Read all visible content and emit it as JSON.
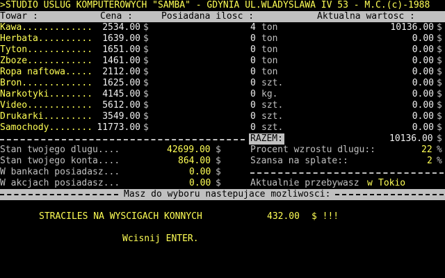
{
  "title": ">STUDIO USLUG KOMPUTEROWYCH \"SAMBA\" - GDYNIA UL.WLADYSLAWA IV 53 - M.C.(c)-1988",
  "headers": {
    "towar": "Towar :",
    "cena": "Cena :",
    "posiadana": "Posiadana ilosc :",
    "wartosc": "Aktualna wartosc :"
  },
  "goods": [
    {
      "name": "Kawa.............",
      "price": "2534.00",
      "cur": "$",
      "qty": "4",
      "unit": "ton",
      "value": "10136.00",
      "vcur": "$"
    },
    {
      "name": "Herbata..........",
      "price": "1639.00",
      "cur": "$",
      "qty": "0",
      "unit": "ton",
      "value": "0.00",
      "vcur": "$"
    },
    {
      "name": "Tyton............",
      "price": "1651.00",
      "cur": "$",
      "qty": "0",
      "unit": "ton",
      "value": "0.00",
      "vcur": "$"
    },
    {
      "name": "Zboze............",
      "price": "1461.00",
      "cur": "$",
      "qty": "0",
      "unit": "ton",
      "value": "0.00",
      "vcur": "$"
    },
    {
      "name": "Ropa naftowa.....",
      "price": "2112.00",
      "cur": "$",
      "qty": "0",
      "unit": "ton",
      "value": "0.00",
      "vcur": "$"
    },
    {
      "name": "Bron.............",
      "price": "1625.00",
      "cur": "$",
      "qty": "0",
      "unit": "szt.",
      "value": "0.00",
      "vcur": "$"
    },
    {
      "name": "Narkotyki........",
      "price": "4145.00",
      "cur": "$",
      "qty": "0",
      "unit": "kg.",
      "value": "0.00",
      "vcur": "$"
    },
    {
      "name": "Video............",
      "price": "5612.00",
      "cur": "$",
      "qty": "0",
      "unit": "szt.",
      "value": "0.00",
      "vcur": "$"
    },
    {
      "name": "Drukarki.........",
      "price": "3549.00",
      "cur": "$",
      "qty": "0",
      "unit": "szt.",
      "value": "0.00",
      "vcur": "$"
    },
    {
      "name": "Samochody........",
      "price": "11773.00",
      "cur": "$",
      "qty": "0",
      "unit": "szt.",
      "value": "0.00",
      "vcur": "$"
    }
  ],
  "razem": {
    "label": "RAZEM:",
    "value": "10136.00",
    "cur": "$"
  },
  "finance": {
    "dlug_label": "Stan twojego dlugu....",
    "dlug_value": "42699.00",
    "konto_label": "Stan twojego konta....",
    "konto_value": "864.00",
    "banki_label": "W bankach posiadasz...",
    "banki_value": "0.00",
    "akcje_label": "W akcjach posiadasz...",
    "akcje_value": "0.00",
    "cur": "$"
  },
  "stats": {
    "procent_label": "Procent wzrostu dlugu::",
    "procent_value": "22",
    "procent_unit": "%",
    "szansa_label": "Szansa na splate::",
    "szansa_value": "2",
    "szansa_unit": "%",
    "location_label": "Aktualnie przebywasz",
    "location_prefix": "w",
    "location_value": "Tokio"
  },
  "options_bar": "Masz do wyboru nastepujace mozliwosci:",
  "message": {
    "text": "STRACILES NA WYSCIGACH KONNYCH",
    "amount": "432.00",
    "suffix": "$ !!!"
  },
  "prompt": "Wcisnij ENTER."
}
